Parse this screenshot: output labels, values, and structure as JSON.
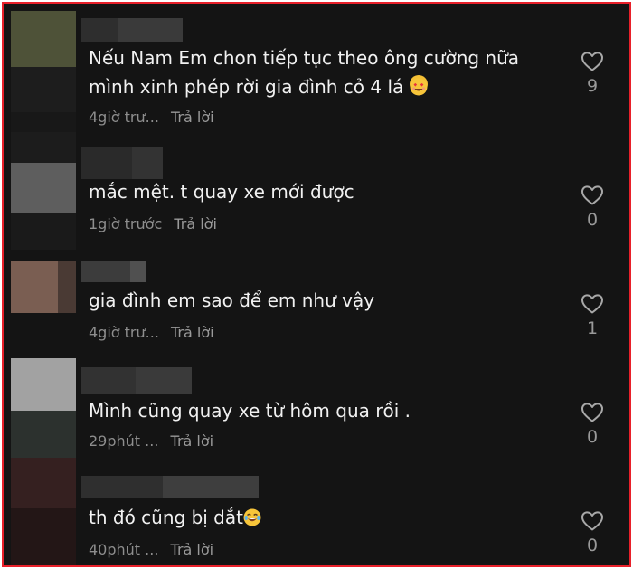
{
  "comments": [
    {
      "text": "Nếu Nam Em chon tiếp tục theo ông cường nữa mình xinh phép rời gia đình cỏ 4 lá",
      "emoji": "smiling-face-with-heart-eyes",
      "time": "4giờ trư...",
      "reply_label": "Trả lời",
      "like_count": "9",
      "avatar_colors": [
        "#4e5238",
        "#232323",
        "#1e1e1e",
        "#191919"
      ],
      "username_colors": [
        "#3a3a3a",
        "#333333",
        "#2e2e2e",
        "#3e3e3e"
      ]
    },
    {
      "text": "mắc mệt. t quay xe mới được",
      "time": "1giờ trước",
      "reply_label": "Trả lời",
      "like_count": "0",
      "avatar_colors": [
        "#2a2a2a",
        "#5a5a5a",
        "#6a6a6a",
        "#2c2c2c"
      ],
      "username_colors": [
        "#2a2a2a",
        "#333333",
        "#2e2e2e",
        "#242424"
      ]
    },
    {
      "text": "gia đình em sao để em như vậy",
      "time": "4giờ trư...",
      "reply_label": "Trả lời",
      "like_count": "1",
      "avatar_colors": [
        "#6b5248",
        "#8a6a5c",
        "#4a3a34",
        "#6e5a50"
      ],
      "username_colors": [
        "#3c3c3c",
        "#444444",
        "#2e2e2e",
        "#505050"
      ]
    },
    {
      "text": "Mình cũng quay xe từ hôm qua rồi .",
      "time": "29phút ...",
      "reply_label": "Trả lời",
      "like_count": "0",
      "avatar_colors": [
        "#9a9a9a",
        "#b4b4b4",
        "#2a2f2c",
        "#353a37"
      ],
      "username_colors": [
        "#323232",
        "#3a3a3a",
        "#2e2e2e",
        "#383838"
      ]
    },
    {
      "text": "th đó cũng bị dắt",
      "emoji": "face-with-tears-of-joy",
      "time": "40phút ...",
      "reply_label": "Trả lời",
      "like_count": "0",
      "avatar_colors": [
        "#3a2222",
        "#2c1a1a",
        "#241616",
        "#1e1414"
      ],
      "username_colors": [
        "#2f2f2f",
        "#3a3a3a",
        "#383838",
        "#444444"
      ]
    }
  ],
  "like_icon": "heart-outline-icon",
  "colors": {
    "background": "#141414",
    "border": "#e8202a",
    "text": "#f1f1f1",
    "meta": "#8e8e8e"
  }
}
